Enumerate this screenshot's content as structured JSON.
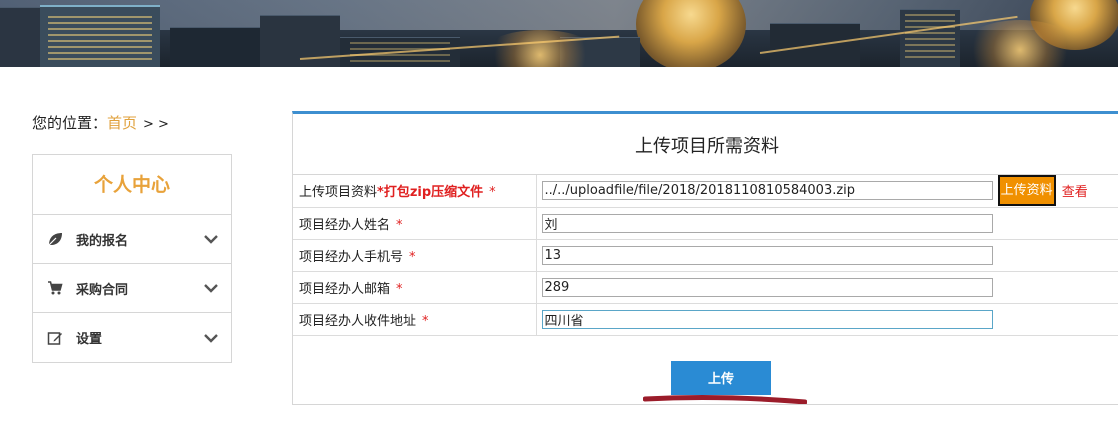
{
  "breadcrumb": {
    "prefix": "您的位置：",
    "home": "首页",
    "sep": "> >"
  },
  "sidebar": {
    "title": "个人中心",
    "items": [
      {
        "label": "我的报名",
        "icon": "leaf-icon"
      },
      {
        "label": "采购合同",
        "icon": "cart-icon"
      },
      {
        "label": "设置",
        "icon": "edit-icon"
      }
    ]
  },
  "form": {
    "title": "上传项目所需资料",
    "upload": {
      "label": "上传项目资料",
      "star": "*",
      "hint": "打包zip压缩文件",
      "req": "*",
      "value": "../../uploadfile/file/2018/2018110810584003.zip",
      "button": "上传资料",
      "view": "查看"
    },
    "fields": [
      {
        "label": "项目经办人姓名",
        "req": "*",
        "value": "刘"
      },
      {
        "label": "项目经办人手机号",
        "req": "*",
        "value": "13"
      },
      {
        "label": "项目经办人邮箱",
        "req": "*",
        "value": "289"
      },
      {
        "label": "项目经办人收件地址",
        "req": "*",
        "value": "四川省"
      }
    ],
    "submit": "上传"
  },
  "colors": {
    "accent_blue": "#2a8bd4",
    "accent_orange": "#f09000",
    "title_orange": "#e8a23a",
    "required_red": "#e02020"
  }
}
